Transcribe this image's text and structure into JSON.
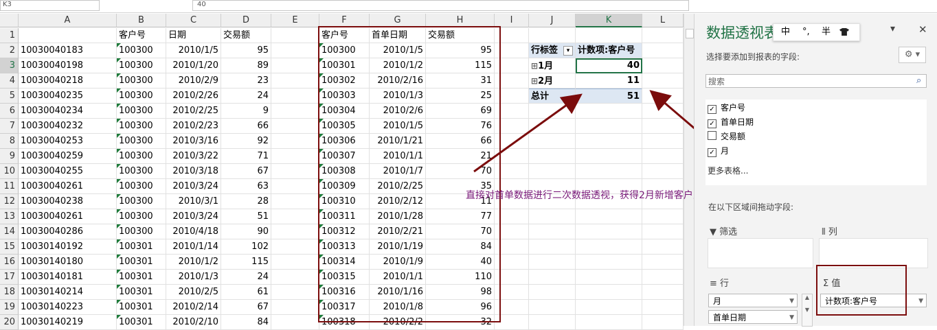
{
  "formula_bar": {
    "name_box": "K3",
    "formula": "40"
  },
  "col_headers": [
    "A",
    "B",
    "C",
    "D",
    "E",
    "F",
    "G",
    "H",
    "I",
    "J",
    "K",
    "L"
  ],
  "row_numbers": [
    "1",
    "2",
    "3",
    "4",
    "5",
    "6",
    "7",
    "8",
    "9",
    "10",
    "11",
    "12",
    "13",
    "14",
    "15",
    "16",
    "17",
    "18",
    "19",
    "20"
  ],
  "left_table": {
    "headers": [
      "",
      "客户号",
      "日期",
      "交易额"
    ],
    "rows": [
      [
        "10030040183",
        "100300",
        "2010/1/5",
        "95"
      ],
      [
        "10030040198",
        "100300",
        "2010/1/20",
        "89"
      ],
      [
        "10030040218",
        "100300",
        "2010/2/9",
        "23"
      ],
      [
        "10030040235",
        "100300",
        "2010/2/26",
        "24"
      ],
      [
        "10030040234",
        "100300",
        "2010/2/25",
        "9"
      ],
      [
        "10030040232",
        "100300",
        "2010/2/23",
        "66"
      ],
      [
        "10030040253",
        "100300",
        "2010/3/16",
        "92"
      ],
      [
        "10030040259",
        "100300",
        "2010/3/22",
        "71"
      ],
      [
        "10030040255",
        "100300",
        "2010/3/18",
        "67"
      ],
      [
        "10030040261",
        "100300",
        "2010/3/24",
        "63"
      ],
      [
        "10030040238",
        "100300",
        "2010/3/1",
        "28"
      ],
      [
        "10030040261",
        "100300",
        "2010/3/24",
        "51"
      ],
      [
        "10030040286",
        "100300",
        "2010/4/18",
        "90"
      ],
      [
        "10030140192",
        "100301",
        "2010/1/14",
        "102"
      ],
      [
        "10030140180",
        "100301",
        "2010/1/2",
        "115"
      ],
      [
        "10030140181",
        "100301",
        "2010/1/3",
        "24"
      ],
      [
        "10030140214",
        "100301",
        "2010/2/5",
        "61"
      ],
      [
        "10030140223",
        "100301",
        "2010/2/14",
        "67"
      ],
      [
        "10030140219",
        "100301",
        "2010/2/10",
        "84"
      ]
    ]
  },
  "mid_table": {
    "headers": [
      "客户号",
      "首单日期",
      "交易额"
    ],
    "rows": [
      [
        "100300",
        "2010/1/5",
        "95"
      ],
      [
        "100301",
        "2010/1/2",
        "115"
      ],
      [
        "100302",
        "2010/2/16",
        "31"
      ],
      [
        "100303",
        "2010/1/3",
        "25"
      ],
      [
        "100304",
        "2010/2/6",
        "69"
      ],
      [
        "100305",
        "2010/1/5",
        "76"
      ],
      [
        "100306",
        "2010/1/21",
        "66"
      ],
      [
        "100307",
        "2010/1/1",
        "21"
      ],
      [
        "100308",
        "2010/1/7",
        "70"
      ],
      [
        "100309",
        "2010/2/25",
        "35"
      ],
      [
        "100310",
        "2010/2/12",
        "11"
      ],
      [
        "100311",
        "2010/1/28",
        "77"
      ],
      [
        "100312",
        "2010/2/21",
        "70"
      ],
      [
        "100313",
        "2010/1/19",
        "84"
      ],
      [
        "100314",
        "2010/1/9",
        "40"
      ],
      [
        "100315",
        "2010/1/1",
        "110"
      ],
      [
        "100316",
        "2010/1/16",
        "98"
      ],
      [
        "100317",
        "2010/1/8",
        "96"
      ],
      [
        "100318",
        "2010/2/2",
        "32"
      ]
    ]
  },
  "pivot": {
    "row_label": "行标签",
    "value_header": "计数项:客户号",
    "rows": [
      {
        "label": "1月",
        "value": "40"
      },
      {
        "label": "2月",
        "value": "11"
      }
    ],
    "total_label": "总计",
    "total_value": "51",
    "expand_glyph": "⊞",
    "filter_glyph": "▾"
  },
  "annotation": "直接对首单数据进行二次数据透视，获得2月新增客户人数",
  "pane": {
    "title": "数据透视表",
    "ime_items": [
      "中",
      "°,",
      "半",
      "shirt-icon"
    ],
    "choose_label": "选择要添加到报表的字段:",
    "search_placeholder": "搜索",
    "fields": [
      {
        "label": "客户号",
        "checked": true
      },
      {
        "label": "首单日期",
        "checked": true
      },
      {
        "label": "交易额",
        "checked": false
      },
      {
        "label": "月",
        "checked": true
      }
    ],
    "more_tables": "更多表格...",
    "drag_label": "在以下区域间拖动字段:",
    "filter_area": "筛选",
    "column_area": "列",
    "row_area": "行",
    "value_area": "值",
    "row_chips": [
      "月",
      "首单日期"
    ],
    "value_chips": [
      "计数项:客户号"
    ],
    "close_glyph": "✕",
    "dropdown_glyph": "▾"
  },
  "colors": {
    "excel_green": "#217346",
    "annotation_red": "#7b0c0c",
    "annotation_text": "#7a1a7a",
    "pivot_header": "#dde7f3"
  }
}
